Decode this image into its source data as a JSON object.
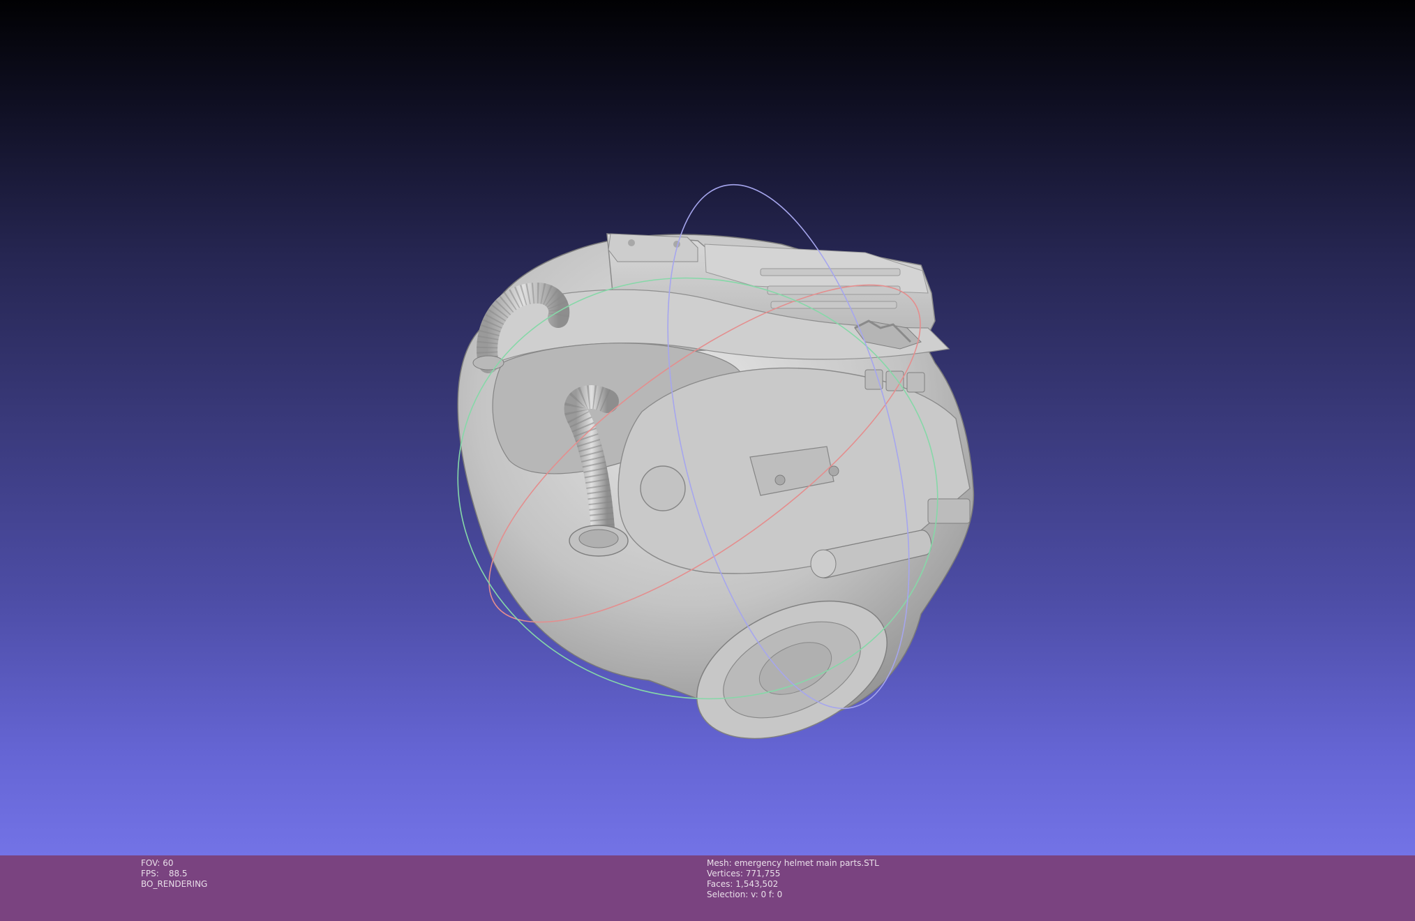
{
  "viewport": {
    "background_top": "#010103",
    "background_bottom": "#7373e6",
    "model_color": "#bdbdbd",
    "trackball": {
      "x_axis_color": "#e88a8a",
      "y_axis_color": "#7ee0a0",
      "z_axis_color": "#9a9ae8"
    }
  },
  "statusbar": {
    "background": "#7a4380",
    "fov_label": "FOV:",
    "fov_value": "60",
    "fps_label": "FPS:",
    "fps_value": "88.5",
    "render_mode": "BO_RENDERING",
    "mesh_line": "Mesh: emergency helmet main parts.STL",
    "vertices_line": "Vertices: 771,755",
    "faces_line": "Faces: 1,543,502",
    "selection_line": "Selection: v: 0 f: 0"
  }
}
